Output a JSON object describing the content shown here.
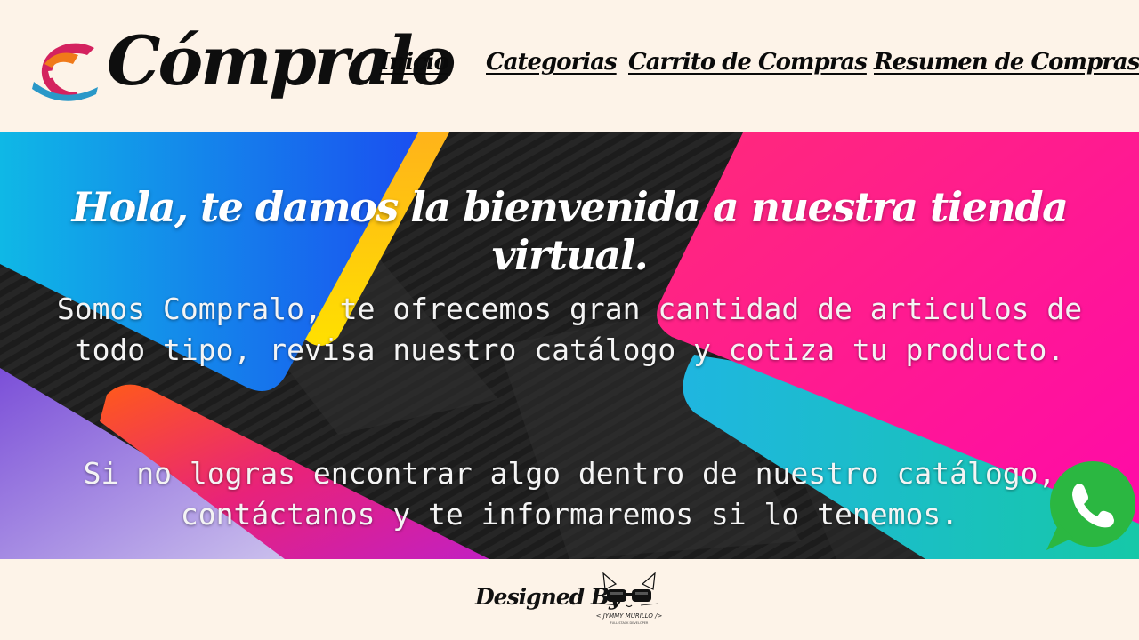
{
  "brand": {
    "name": "Cómpralo",
    "colors": {
      "primary": "#d4225f",
      "accent": "#f07a1a",
      "secondary": "#2a98c8"
    }
  },
  "nav": {
    "items": [
      {
        "label": "Inicio"
      },
      {
        "label": "Categorias"
      },
      {
        "label": "Carrito de Compras"
      },
      {
        "label": "Resumen de Compras"
      }
    ]
  },
  "hero": {
    "title": "Hola, te damos la bienvenida a nuestra tienda virtual.",
    "paragraph1": "Somos Compralo, te ofrecemos gran cantidad de articulos de todo tipo, revisa nuestro catálogo y cotiza tu producto.",
    "paragraph2": "Si no logras encontrar algo dentro de nuestro catálogo, contáctanos y te informaremos si lo tenemos."
  },
  "whatsapp": {
    "icon": "whatsapp-icon",
    "color": "#2bb741"
  },
  "footer": {
    "designed_by": "Designed By",
    "author": "< JYMMY MURILLO />",
    "author_subtitle": "FULL STACK DEVELOPER"
  }
}
